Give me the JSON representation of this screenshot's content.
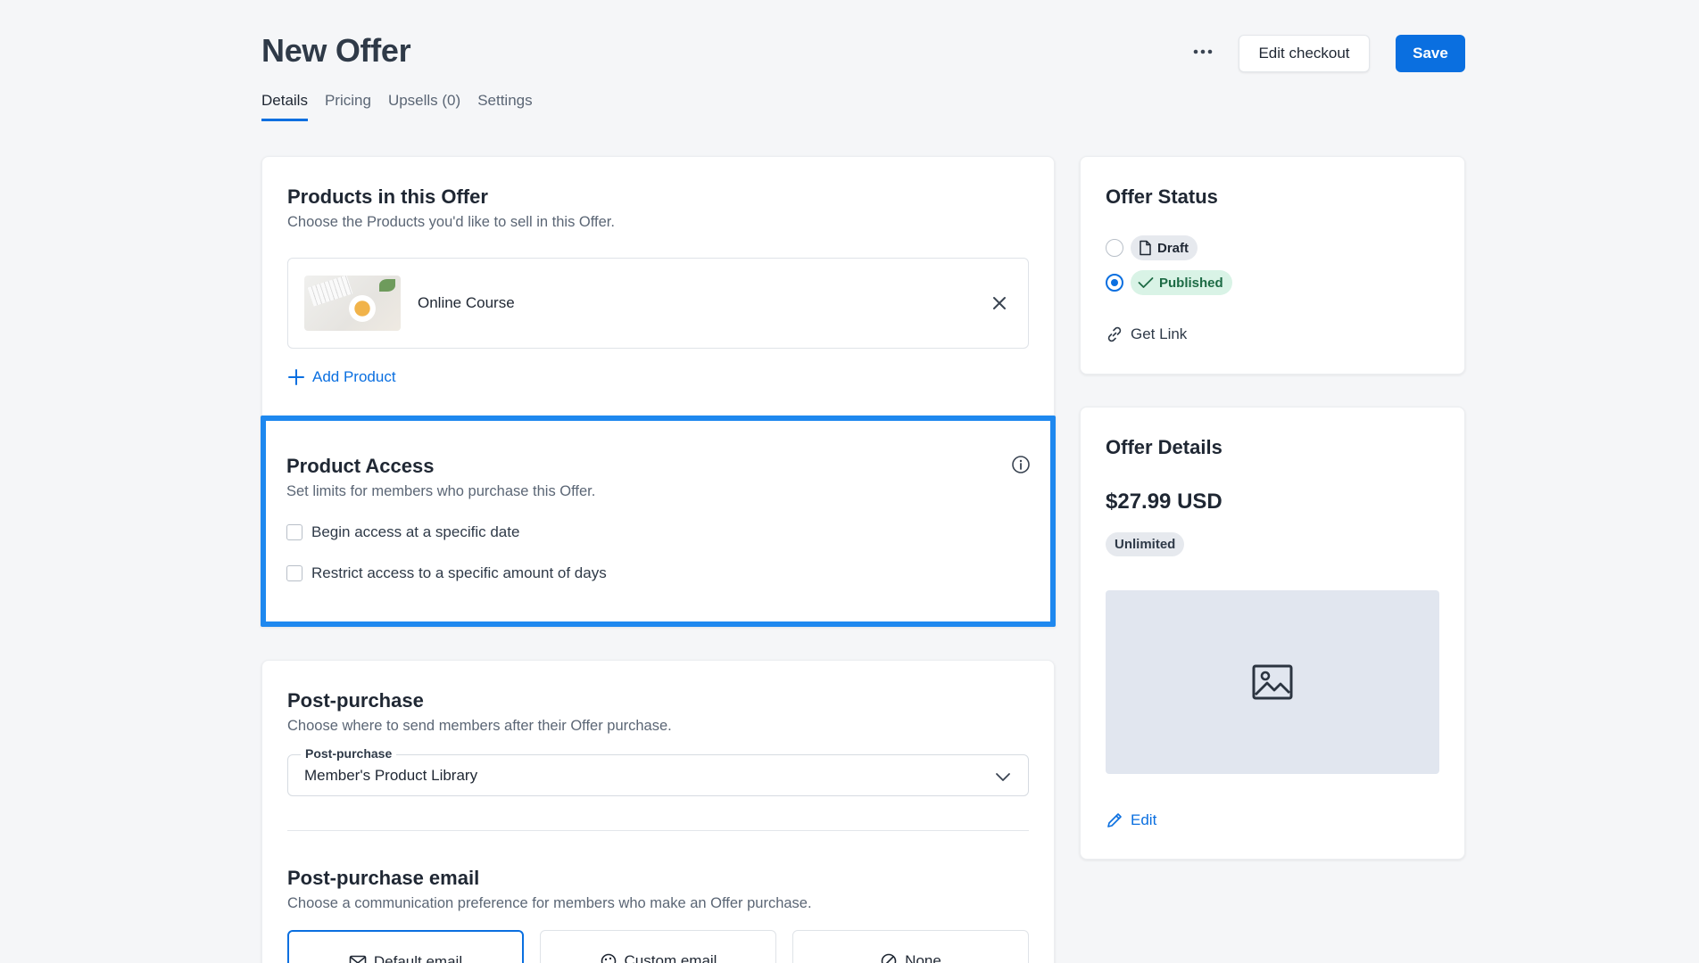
{
  "header": {
    "title": "New Offer",
    "edit_checkout_label": "Edit checkout",
    "save_label": "Save"
  },
  "tabs": [
    {
      "label": "Details",
      "active": true
    },
    {
      "label": "Pricing",
      "active": false
    },
    {
      "label": "Upsells (0)",
      "active": false
    },
    {
      "label": "Settings",
      "active": false
    }
  ],
  "products": {
    "title": "Products in this Offer",
    "subtitle": "Choose the Products you'd like to sell in this Offer.",
    "items": [
      {
        "name": "Online Course"
      }
    ],
    "add_label": "Add Product"
  },
  "access": {
    "title": "Product Access",
    "subtitle": "Set limits for members who purchase this Offer.",
    "options": [
      {
        "label": "Begin access at a specific date",
        "checked": false
      },
      {
        "label": "Restrict access to a specific amount of days",
        "checked": false
      }
    ]
  },
  "post_purchase": {
    "title": "Post-purchase",
    "subtitle": "Choose where to send members after their Offer purchase.",
    "select_label": "Post-purchase",
    "select_value": "Member's Product Library"
  },
  "post_email": {
    "title": "Post-purchase email",
    "subtitle": "Choose a communication preference for members who make an Offer purchase.",
    "options": [
      {
        "label": "Default email",
        "selected": true
      },
      {
        "label": "Custom email",
        "selected": false
      },
      {
        "label": "None",
        "selected": false
      }
    ]
  },
  "status": {
    "title": "Offer Status",
    "draft_label": "Draft",
    "published_label": "Published",
    "selected": "Published",
    "get_link_label": "Get Link"
  },
  "offer_details": {
    "title": "Offer Details",
    "price": "$27.99 USD",
    "badge": "Unlimited",
    "edit_label": "Edit"
  },
  "colors": {
    "accent": "#0a6fe0",
    "highlight": "#1e88ef",
    "published_bg": "#d9f3e6"
  }
}
